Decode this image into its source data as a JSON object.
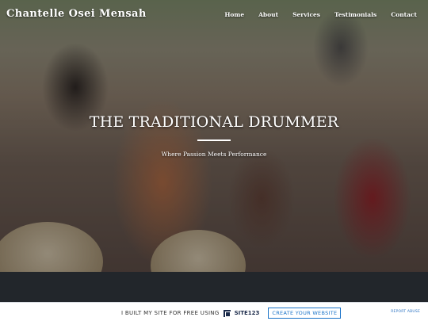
{
  "site": {
    "brand": "Chantelle Osei Mensah"
  },
  "nav": {
    "items": [
      "Home",
      "About",
      "Services",
      "Testimonials",
      "Contact"
    ]
  },
  "hero": {
    "title": "THE TRADITIONAL DRUMMER",
    "tagline": "Where Passion Meets Performance"
  },
  "promo": {
    "built_text": "I BUILT MY SITE FOR FREE USING",
    "logo_text": "SITE123",
    "cta_label": "CREATE YOUR WEBSITE",
    "report_label": "REPORT ABUSE"
  },
  "colors": {
    "band": "#22262b",
    "cta": "#1a73c8"
  }
}
